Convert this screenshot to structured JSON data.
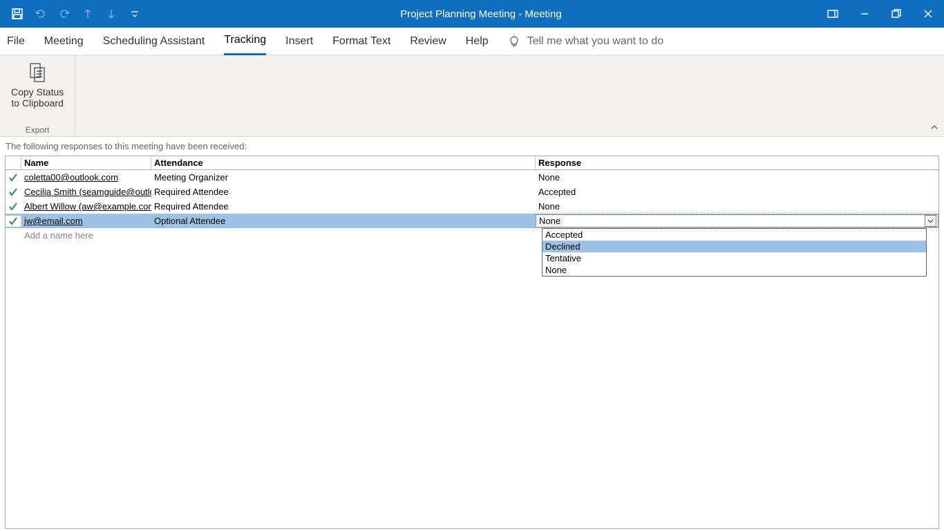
{
  "window": {
    "title": "Project Planning Meeting  -  Meeting"
  },
  "tabs": {
    "file": "File",
    "meeting": "Meeting",
    "scheduling": "Scheduling Assistant",
    "tracking": "Tracking",
    "insert": "Insert",
    "format": "Format Text",
    "review": "Review",
    "help": "Help",
    "tellme": "Tell me what you want to do"
  },
  "ribbon": {
    "copy_status_line1": "Copy Status",
    "copy_status_line2": "to Clipboard",
    "export_group": "Export"
  },
  "status_line": "The following responses to this meeting have been received:",
  "columns": {
    "name": "Name",
    "attendance": "Attendance",
    "response": "Response"
  },
  "rows": [
    {
      "name": "coletta00@outlook.com",
      "attendance": "Meeting Organizer",
      "response": "None"
    },
    {
      "name": "Cecilia Smith (seamguide@outlo",
      "attendance": "Required Attendee",
      "response": "Accepted"
    },
    {
      "name": "Albert Willow (aw@example.com",
      "attendance": "Required Attendee",
      "response": "None"
    },
    {
      "name": "jw@email.com",
      "attendance": "Optional Attendee",
      "response": "None"
    }
  ],
  "add_placeholder": "Add a name here",
  "dropdown": {
    "options": [
      "Accepted",
      "Declined",
      "Tentative",
      "None"
    ],
    "highlight_index": 1
  }
}
